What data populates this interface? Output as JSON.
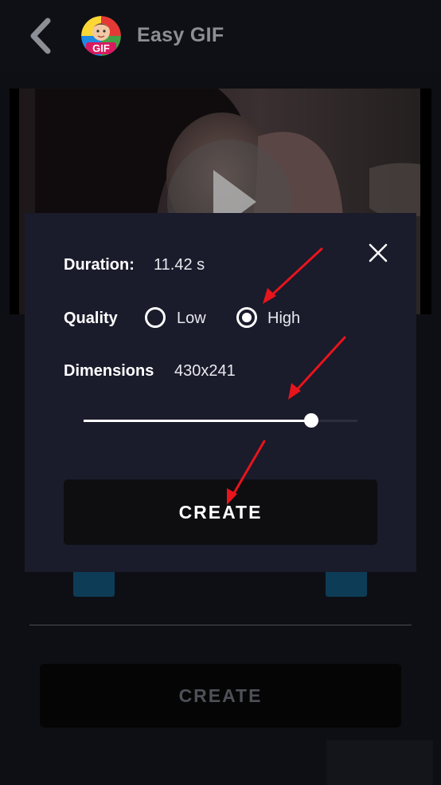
{
  "header": {
    "title": "Easy GIF",
    "logo_text": "GIF",
    "back_icon": "chevron-left-icon"
  },
  "dialog": {
    "duration_label": "Duration:",
    "duration_value": "11.42 s",
    "quality_label": "Quality",
    "quality_options": [
      {
        "label": "Low",
        "selected": false
      },
      {
        "label": "High",
        "selected": true
      }
    ],
    "dimensions_label": "Dimensions",
    "dimensions_value": "430x241",
    "slider_value_fraction": 0.83,
    "create_label": "CREATE",
    "close_icon": "close-icon"
  },
  "background": {
    "create_label": "CREATE"
  },
  "colors": {
    "dialog_bg": "#1a1b2b",
    "annotation_arrow": "#e8141b",
    "accent_blue": "#0d3c57"
  }
}
